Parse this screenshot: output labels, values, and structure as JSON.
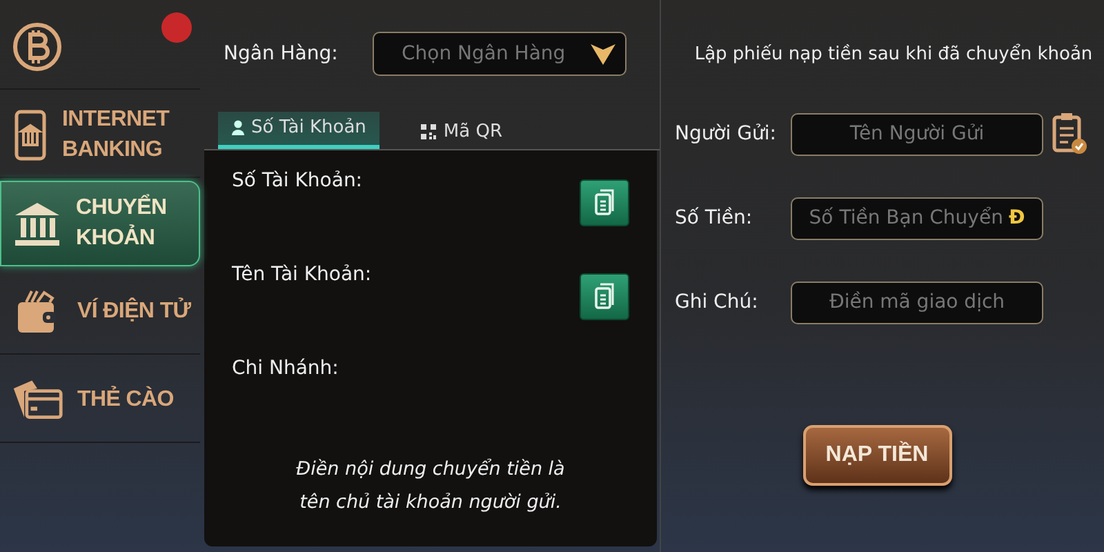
{
  "sidebar": {
    "items": [
      {
        "kind": "bitcoin",
        "selected": false,
        "badge": true
      },
      {
        "kind": "phone-bank",
        "label": "INTERNET BANKING",
        "selected": false,
        "badge": false
      },
      {
        "kind": "bank",
        "label": "CHUYỂN KHOẢN",
        "selected": true,
        "badge": false
      },
      {
        "kind": "wallet",
        "label": "VÍ ĐIỆN TỬ",
        "selected": false,
        "badge": false
      },
      {
        "kind": "card",
        "label": "THẺ CÀO",
        "selected": false,
        "badge": false
      }
    ]
  },
  "bank_select": {
    "label": "Ngân Hàng:",
    "placeholder": "Chọn Ngân Hàng"
  },
  "tabs": [
    {
      "kind": "person",
      "label": "Số Tài Khoản",
      "selected": true
    },
    {
      "kind": "qr",
      "label": "Mã QR",
      "selected": false
    }
  ],
  "account_panel": {
    "fields": [
      {
        "label": "Số Tài Khoản:",
        "copy": true
      },
      {
        "label": "Tên Tài Khoản:",
        "copy": true
      },
      {
        "label": "Chi Nhánh:",
        "copy": false
      }
    ],
    "note": "Điền nội dung chuyển tiền là tên chủ tài khoản người gửi."
  },
  "deposit_form": {
    "title": "Lập phiếu nạp tiền sau khi đã chuyển khoản",
    "fields": [
      {
        "label": "Người Gửi:",
        "placeholder": "Tên Người Gửi",
        "kind": "clipboard"
      },
      {
        "label": "Số Tiền:",
        "placeholder": "Số Tiền Bạn Chuyển",
        "kind": "currency",
        "suffix": "Đ"
      },
      {
        "label": "Ghi Chú:",
        "placeholder": "Điền mã giao dịch",
        "kind": "plain"
      }
    ],
    "submit": "NẠP TIỀN"
  }
}
